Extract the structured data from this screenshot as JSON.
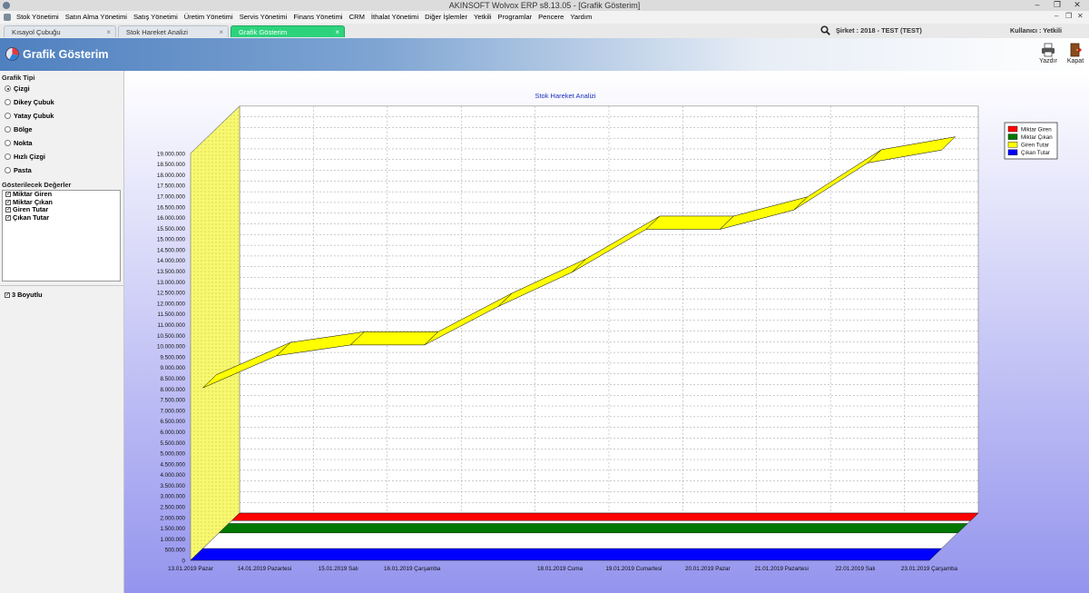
{
  "window": {
    "title": "AKINSOFT Wolvox ERP s8.13.05 - [Grafik Gösterim]",
    "minimize": "–",
    "restore": "❐",
    "close": "✕"
  },
  "menu": {
    "items": [
      "Stok Yönetimi",
      "Satın Alma Yönetimi",
      "Satış Yönetimi",
      "Üretim Yönetimi",
      "Servis Yönetimi",
      "Finans Yönetimi",
      "CRM",
      "İthalat Yönetimi",
      "Diğer İşlemler",
      "Yetkili",
      "Programlar",
      "Pencere",
      "Yardım"
    ],
    "controls": [
      "–",
      "❐",
      "✕"
    ]
  },
  "tabs": [
    {
      "label": "Kısayol Çubuğu",
      "close": "×",
      "active": false
    },
    {
      "label": "Stok Hareket Analizi",
      "close": "×",
      "active": false
    },
    {
      "label": "Grafik Gösterim",
      "close": "×",
      "active": true
    }
  ],
  "status": {
    "company": "Şirket : 2018 - TEST (TEST)",
    "user": "Kullanıcı : Yetkili"
  },
  "header": {
    "title": "Grafik Gösterim",
    "print_label": "Yazdır",
    "close_label": "Kapat"
  },
  "left": {
    "chart_type_title": "Grafik Tipi",
    "chart_types": [
      {
        "label": "Çizgi",
        "selected": true
      },
      {
        "label": "Dikey Çubuk",
        "selected": false
      },
      {
        "label": "Yatay Çubuk",
        "selected": false
      },
      {
        "label": "Bölge",
        "selected": false
      },
      {
        "label": "Nokta",
        "selected": false
      },
      {
        "label": "Hızlı Çizgi",
        "selected": false
      },
      {
        "label": "Pasta",
        "selected": false
      }
    ],
    "values_title": "Gösterilecek Değerler",
    "values": [
      {
        "label": "Miktar Giren",
        "checked": true
      },
      {
        "label": "Miktar Çıkan",
        "checked": true
      },
      {
        "label": "Giren Tutar",
        "checked": true
      },
      {
        "label": "Çıkan Tutar",
        "checked": true
      }
    ],
    "three_d_label": "3 Boyutlu",
    "three_d_checked": true
  },
  "colors": {
    "accent_tab": "#2dd37c",
    "plot_background": "#ffffff",
    "chart_background_top": "#ffffff",
    "chart_background_bottom": "#9494ee",
    "side_wall": "#f8f870"
  },
  "chart_data": {
    "type": "line",
    "title": "Stok Hareket Analizi",
    "three_d": true,
    "categories": [
      "13.01.2019 Pazar",
      "14.01.2019 Pazartesi",
      "15.01.2019 Salı",
      "16.01.2019 Çarşamba",
      "18.01.2019 Cuma",
      "19.01.2019 Cumartesi",
      "20.01.2019 Pazar",
      "21.01.2019 Pazartesi",
      "22.01.2019 Salı",
      "23.01.2019 Çarşamba"
    ],
    "x_positions": [
      0,
      1,
      2,
      3,
      5,
      6,
      7,
      8,
      9,
      10
    ],
    "ylim": [
      0,
      19000000
    ],
    "ytick_step": 500000,
    "ytick_labels": [
      "0",
      "500.000",
      "1.000.000",
      "1.500.000",
      "2.000.000",
      "2.500.000",
      "3.000.000",
      "3.500.000",
      "4.000.000",
      "4.500.000",
      "5.000.000",
      "5.500.000",
      "6.000.000",
      "6.500.000",
      "7.000.000",
      "7.500.000",
      "8.000.000",
      "8.500.000",
      "9.000.000",
      "9.500.000",
      "10.000.000",
      "10.500.000",
      "11.000.000",
      "11.500.000",
      "12.000.000",
      "12.500.000",
      "13.000.000",
      "13.500.000",
      "14.000.000",
      "14.500.000",
      "15.000.000",
      "15.500.000",
      "16.000.000",
      "16.500.000",
      "17.000.000",
      "17.500.000",
      "18.000.000",
      "18.500.000",
      "19.000.000"
    ],
    "grid": true,
    "legend_position": "top-right",
    "series": [
      {
        "name": "Miktar Giren",
        "color": "#ff0000",
        "values": [
          0,
          0,
          0,
          0,
          0,
          0,
          0,
          0,
          0,
          0,
          0
        ]
      },
      {
        "name": "Miktar Çıkan",
        "color": "#007800",
        "values": [
          0,
          0,
          0,
          0,
          0,
          0,
          0,
          0,
          0,
          0,
          0
        ]
      },
      {
        "name": "Giren Tutar",
        "color": "#ffff00",
        "values": [
          7500000,
          9000000,
          9500000,
          9500000,
          11300000,
          12900000,
          14900000,
          14900000,
          15800000,
          18000000,
          18600000
        ]
      },
      {
        "name": "Çıkan Tutar",
        "color": "#0000ff",
        "values": [
          0,
          0,
          0,
          0,
          0,
          0,
          0,
          0,
          0,
          0,
          0
        ]
      }
    ]
  }
}
